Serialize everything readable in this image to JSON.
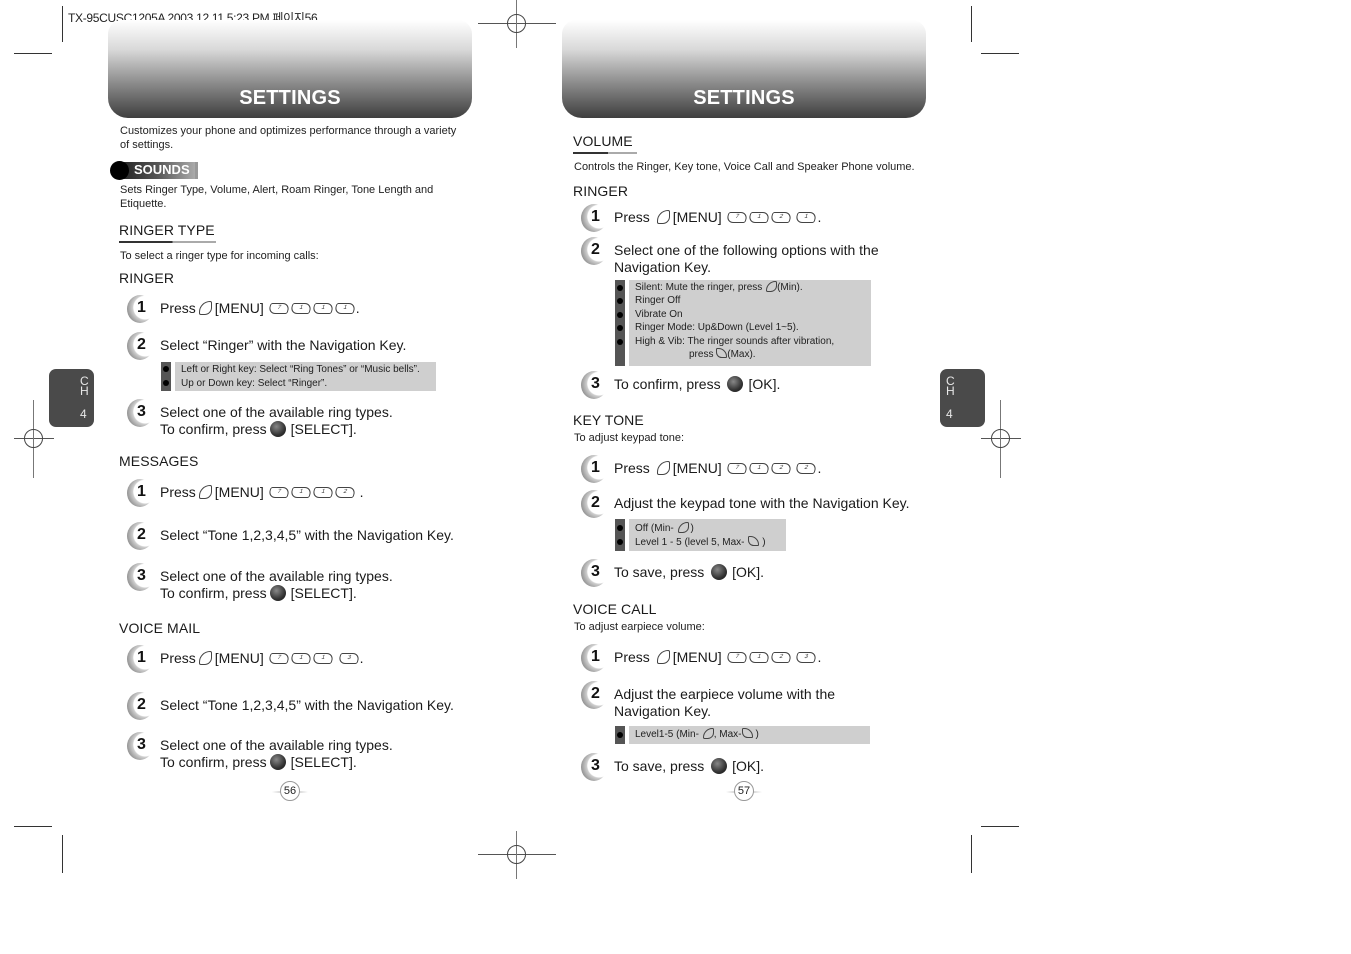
{
  "print_header": "TX-95CUSC1205A  2003.12.11 5:23 PM 페이지56",
  "left_page": {
    "banner_title": "SETTINGS",
    "chapter_tab": {
      "l1": "C",
      "l2": "H",
      "num": "4"
    },
    "intro": [
      "Customizes your phone and optimizes performance through a variety",
      "of settings."
    ],
    "badge": "SOUNDS",
    "badge_desc": [
      "Sets Ringer Type, Volume, Alert, Roam Ringer, Tone Length and",
      "Etiquette."
    ],
    "section_title": "RINGER TYPE",
    "section_desc": "To select a ringer type for incoming calls:",
    "ringer": {
      "title": "RINGER",
      "steps": [
        {
          "num": "1",
          "text_before": "Press",
          "text_menu": "[MENU]",
          "keys": [
            "7",
            "1",
            "1",
            "1"
          ],
          "end": "."
        },
        {
          "num": "2",
          "text": "Select “Ringer” with the Navigation Key."
        },
        {
          "num": "3",
          "text": "Select one of the available ring types.",
          "line2_before": "To confirm, press",
          "line2_after": "[SELECT]."
        }
      ],
      "note": [
        "Left or Right key: Select “Ring Tones” or “Music bells”.",
        "Up or Down key: Select “Ringer”."
      ]
    },
    "messages": {
      "title": "MESSAGES",
      "steps": [
        {
          "num": "1",
          "text_before": "Press",
          "text_menu": "[MENU]",
          "keys": [
            "7",
            "1",
            "1",
            "2"
          ],
          "end": "."
        },
        {
          "num": "2",
          "text": "Select “Tone 1,2,3,4,5” with the Navigation Key."
        },
        {
          "num": "3",
          "text": "Select one of the available ring types.",
          "line2_before": "To confirm, press",
          "line2_after": "[SELECT]."
        }
      ]
    },
    "voice_mail": {
      "title": "VOICE MAIL",
      "steps": [
        {
          "num": "1",
          "text_before": "Press",
          "text_menu": "[MENU]",
          "keys": [
            "7",
            "1",
            "1",
            "3"
          ],
          "end": "."
        },
        {
          "num": "2",
          "text": "Select “Tone 1,2,3,4,5” with the Navigation Key."
        },
        {
          "num": "3",
          "text": "Select one of the available ring types.",
          "line2_before": "To confirm, press",
          "line2_after": "[SELECT]."
        }
      ]
    },
    "page_number": "56"
  },
  "right_page": {
    "banner_title": "SETTINGS",
    "chapter_tab": {
      "l1": "C",
      "l2": "H",
      "num": "4"
    },
    "section_title": "VOLUME",
    "section_desc": "Controls the Ringer, Key tone, Voice Call and Speaker Phone volume.",
    "ringer": {
      "title": "RINGER",
      "steps": [
        {
          "num": "1",
          "text_before": "Press",
          "text_menu": "[MENU]",
          "keys": [
            "7",
            "1",
            "2",
            "1"
          ],
          "end": "."
        },
        {
          "num": "2",
          "text": "Select one of the following options with the",
          "line2": "Navigation Key."
        },
        {
          "num": "3",
          "text_before": "To confirm, press",
          "text_after": "[OK]."
        }
      ],
      "note": [
        "Silent: Mute the ringer, press",
        "(Min).",
        "Ringer Off",
        "Vibrate On",
        "Ringer Mode: Up&Down (Level 1~5).",
        "High & Vib: The ringer sounds  after vibration,",
        "press",
        "(Max)."
      ]
    },
    "key_tone": {
      "title": "KEY TONE",
      "desc": "To adjust keypad tone:",
      "steps": [
        {
          "num": "1",
          "text_before": "Press",
          "text_menu": "[MENU]",
          "keys": [
            "7",
            "1",
            "2",
            "2"
          ],
          "end": "."
        },
        {
          "num": "2",
          "text": "Adjust the keypad tone with the Navigation Key."
        },
        {
          "num": "3",
          "text_before": "To save, press",
          "text_after": "[OK]."
        }
      ],
      "note": [
        "Off (Min-",
        ")",
        "Level 1 - 5 (level 5, Max-",
        ")"
      ]
    },
    "voice_call": {
      "title": "VOICE CALL",
      "desc": "To adjust earpiece volume:",
      "steps": [
        {
          "num": "1",
          "text_before": "Press",
          "text_menu": "[MENU]",
          "keys": [
            "7",
            "1",
            "2",
            "3"
          ],
          "end": "."
        },
        {
          "num": "2",
          "text": "Adjust the earpiece volume with the",
          "line2": "Navigation Key."
        },
        {
          "num": "3",
          "text_before": "To save, press",
          "text_after": "[OK]."
        }
      ],
      "note": [
        "Level1-5 (Min-",
        ", Max-",
        ")"
      ]
    },
    "page_number": "57"
  }
}
